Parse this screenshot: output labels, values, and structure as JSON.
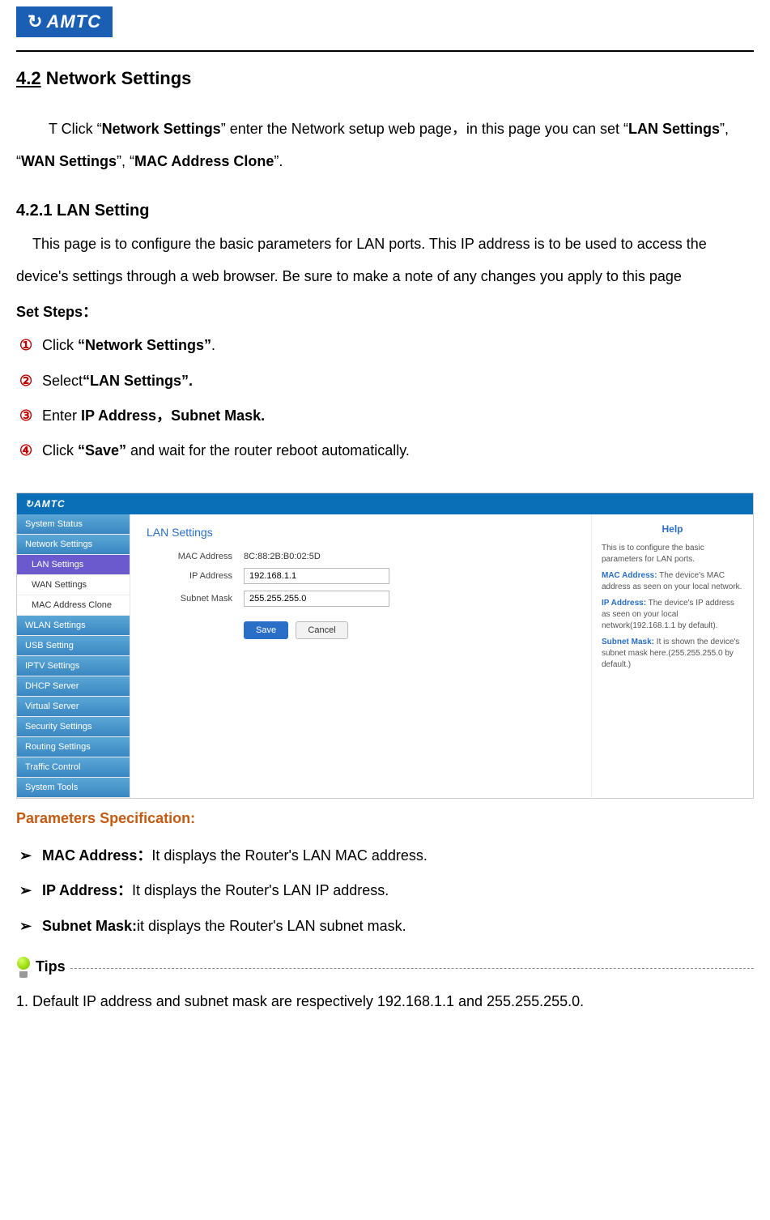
{
  "logo": "AMTC",
  "section": {
    "num": "4.2",
    "title": "Network Settings"
  },
  "intro": {
    "p1a": "T Click “",
    "p1b": "Network Settings",
    "p1c": "” enter the Network setup web page，in this page you can set “",
    "p1d": "LAN Settings",
    "p1e": "”, “",
    "p1f": "WAN Settings",
    "p1g": "”, “",
    "p1h": "MAC Address Clone",
    "p1i": "”."
  },
  "sub": {
    "num": "4.2.1",
    "title": "LAN Setting"
  },
  "subtext": "This page is to configure the basic parameters for LAN ports. This IP address is to be used to access the device's settings through a web browser. Be sure to make a note of any changes you apply to this page",
  "setsteps_label": "Set Steps：",
  "steps": {
    "s1": {
      "n": "①",
      "a": "Click ",
      "b": "“Network Settings”",
      "c": "."
    },
    "s2": {
      "n": "②",
      "a": "Select",
      "b": "“LAN Settings”."
    },
    "s3": {
      "n": "③",
      "a": "Enter ",
      "b": "IP Address，Subnet Mask."
    },
    "s4": {
      "n": "④",
      "a": "Click ",
      "b": "“Save”",
      "c": " and wait for the router reboot automatically."
    }
  },
  "shot": {
    "brand": "AMTC",
    "side": {
      "items": [
        "System Status",
        "Network Settings",
        "WLAN Settings",
        "USB Setting",
        "IPTV Settings",
        "DHCP Server",
        "Virtual Server",
        "Security Settings",
        "Routing Settings",
        "Traffic Control",
        "System Tools"
      ],
      "subs": [
        "LAN Settings",
        "WAN Settings",
        "MAC Address Clone"
      ]
    },
    "main": {
      "title": "LAN Settings",
      "mac_label": "MAC Address",
      "mac_value": "8C:88:2B:B0:02:5D",
      "ip_label": "IP Address",
      "ip_value": "192.168.1.1",
      "mask_label": "Subnet Mask",
      "mask_value": "255.255.255.0",
      "save": "Save",
      "cancel": "Cancel"
    },
    "help": {
      "title": "Help",
      "intro": "This is to configure the basic parameters for LAN ports.",
      "mac_k": "MAC Address:",
      "mac_v": " The device's MAC address as seen on your local network.",
      "ip_k": "IP Address:",
      "ip_v": " The device's IP address as seen on your local network(192.168.1.1 by default).",
      "mask_k": "Subnet Mask:",
      "mask_v": " It is shown the device's subnet mask here.(255.255.255.0 by default.)"
    }
  },
  "params": {
    "title": "Parameters Specification:",
    "p1": {
      "k": "MAC Address：",
      "v": "It displays the Router's LAN MAC address."
    },
    "p2": {
      "k": "IP Address：",
      "v": "It displays the Router's LAN IP address."
    },
    "p3": {
      "k": "Subnet Mask:",
      "v": "it displays the Router's LAN subnet mask."
    }
  },
  "tips_label": "Tips",
  "tip1": "1. Default IP address and subnet mask are respectively 192.168.1.1 and 255.255.255.0."
}
